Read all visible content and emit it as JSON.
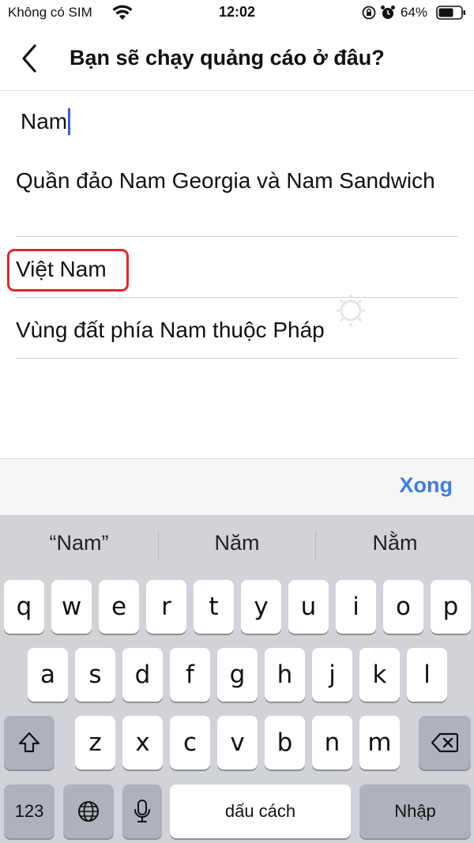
{
  "status": {
    "carrier": "Không có SIM",
    "time": "12:02",
    "battery": "64%"
  },
  "header": {
    "title": "Bạn sẽ chạy quảng cáo ở đâu?"
  },
  "search": {
    "value": "Nam"
  },
  "results": [
    {
      "label": "Quần đảo Nam Georgia và Nam Sandwich"
    },
    {
      "label": "Việt Nam"
    },
    {
      "label": "Vùng đất phía Nam thuộc Pháp"
    }
  ],
  "accessory": {
    "done": "Xong"
  },
  "keyboard": {
    "suggestions": [
      "“Nam”",
      "Năm",
      "Nằm"
    ],
    "row1": [
      "q",
      "w",
      "e",
      "r",
      "t",
      "y",
      "u",
      "i",
      "o",
      "p"
    ],
    "row2": [
      "a",
      "s",
      "d",
      "f",
      "g",
      "h",
      "j",
      "k",
      "l"
    ],
    "row3": [
      "z",
      "x",
      "c",
      "v",
      "b",
      "n",
      "m"
    ],
    "numbers_key": "123",
    "space_key": "dấu cách",
    "return_key": "Nhập"
  },
  "colors": {
    "accent": "#3a7ee4",
    "highlight": "#e0262f",
    "cursor": "#3b5bdb"
  }
}
